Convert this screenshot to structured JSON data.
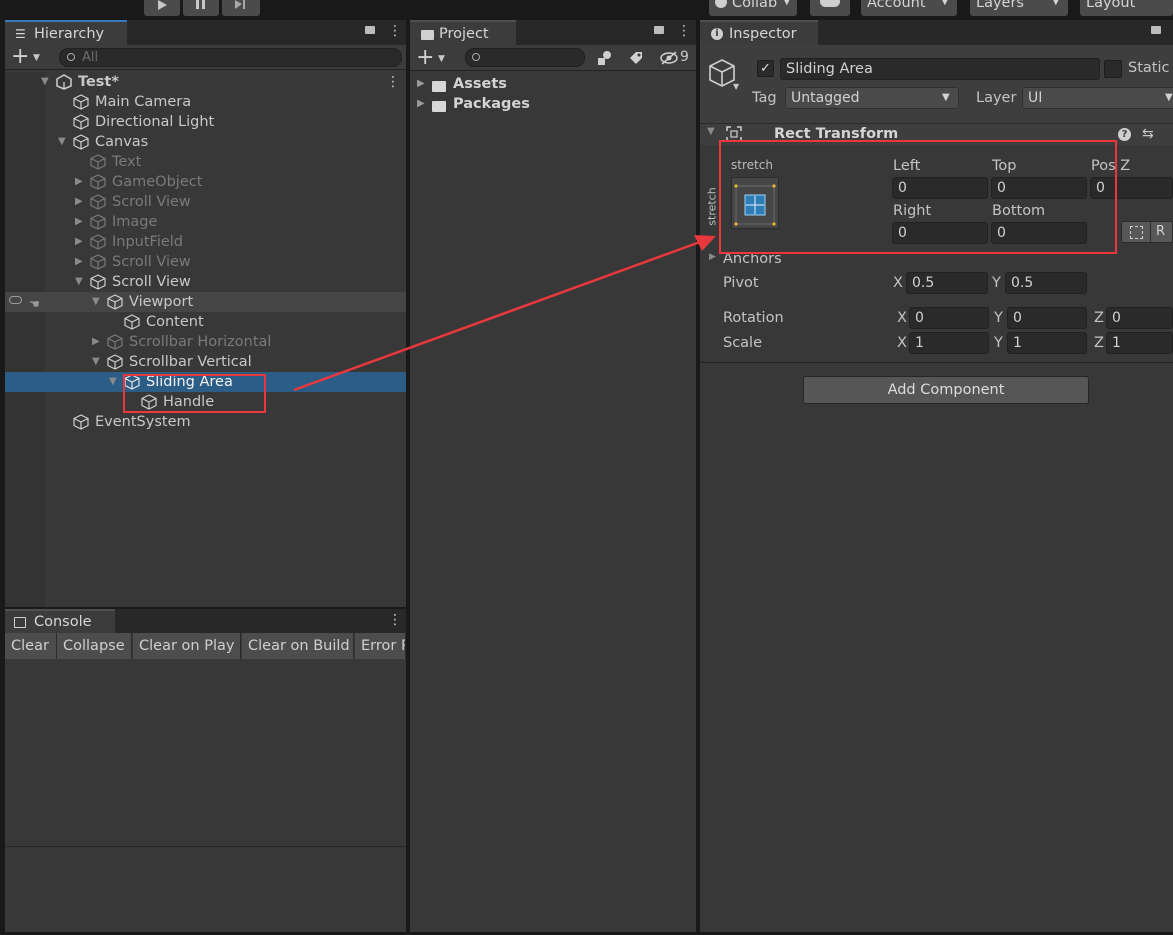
{
  "toolbar": {
    "collab_label": "Collab",
    "account_label": "Account",
    "layers_label": "Layers",
    "layout_label": "Layout"
  },
  "hierarchy": {
    "tab_label": "Hierarchy",
    "search_placeholder": "All",
    "items": [
      {
        "label": "Test*",
        "depth": 0,
        "expanded": true,
        "icon": "unity-scene-icon",
        "dim": false,
        "bold": true
      },
      {
        "label": "Main Camera",
        "depth": 1,
        "icon": "gameobject-cube-icon",
        "dim": false
      },
      {
        "label": "Directional Light",
        "depth": 1,
        "icon": "gameobject-cube-icon",
        "dim": false
      },
      {
        "label": "Canvas",
        "depth": 1,
        "expanded": true,
        "icon": "gameobject-cube-icon",
        "dim": false
      },
      {
        "label": "Text",
        "depth": 2,
        "icon": "gameobject-cube-icon",
        "dim": true
      },
      {
        "label": "GameObject",
        "depth": 2,
        "collapsed": true,
        "icon": "gameobject-cube-icon",
        "dim": true
      },
      {
        "label": "Scroll View",
        "depth": 2,
        "collapsed": true,
        "icon": "gameobject-cube-icon",
        "dim": true
      },
      {
        "label": "Image",
        "depth": 2,
        "collapsed": true,
        "icon": "gameobject-cube-icon",
        "dim": true
      },
      {
        "label": "InputField",
        "depth": 2,
        "collapsed": true,
        "icon": "gameobject-cube-icon",
        "dim": true
      },
      {
        "label": "Scroll View",
        "depth": 2,
        "collapsed": true,
        "icon": "gameobject-cube-icon",
        "dim": true
      },
      {
        "label": "Scroll View",
        "depth": 2,
        "expanded": true,
        "icon": "gameobject-cube-icon",
        "dim": false
      },
      {
        "label": "Viewport",
        "depth": 3,
        "expanded": true,
        "icon": "gameobject-cube-icon",
        "dim": false,
        "hovered": true
      },
      {
        "label": "Content",
        "depth": 4,
        "icon": "gameobject-cube-icon",
        "dim": false
      },
      {
        "label": "Scrollbar Horizontal",
        "depth": 3,
        "collapsed": true,
        "icon": "gameobject-cube-icon",
        "dim": true
      },
      {
        "label": "Scrollbar Vertical",
        "depth": 3,
        "expanded": true,
        "icon": "gameobject-cube-icon",
        "dim": false
      },
      {
        "label": "Sliding Area",
        "depth": 4,
        "expanded": true,
        "icon": "gameobject-cube-icon",
        "dim": false,
        "selected": true
      },
      {
        "label": "Handle",
        "depth": 5,
        "icon": "gameobject-cube-icon",
        "dim": false
      },
      {
        "label": "EventSystem",
        "depth": 1,
        "icon": "gameobject-cube-icon",
        "dim": false
      }
    ]
  },
  "project": {
    "tab_label": "Project",
    "hidden_count": "9",
    "folders": [
      "Assets",
      "Packages"
    ]
  },
  "console": {
    "tab_label": "Console",
    "buttons": [
      "Clear",
      "Collapse",
      "Clear on Play",
      "Clear on Build",
      "Error P"
    ]
  },
  "inspector": {
    "tab_label": "Inspector",
    "object_name": "Sliding Area",
    "active": true,
    "static_label": "Static",
    "tag_label": "Tag",
    "tag_value": "Untagged",
    "layer_label": "Layer",
    "layer_value": "UI",
    "component_title": "Rect Transform",
    "anchor_preset_label": "stretch",
    "anchor_preset_side_label": "stretch",
    "left_label": "Left",
    "left_value": "0",
    "top_label": "Top",
    "top_value": "0",
    "posz_label": "Pos Z",
    "posz_value": "0",
    "right_label": "Right",
    "right_value": "0",
    "bottom_label": "Bottom",
    "bottom_value": "0",
    "raw_edit_label": "R",
    "anchors_label": "Anchors",
    "pivot_label": "Pivot",
    "pivot_x": "0.5",
    "pivot_y": "0.5",
    "rotation_label": "Rotation",
    "rotation_x": "0",
    "rotation_y": "0",
    "rotation_z": "0",
    "scale_label": "Scale",
    "scale_x": "1",
    "scale_y": "1",
    "scale_z": "1",
    "axis_x": "X",
    "axis_y": "Y",
    "axis_z": "Z",
    "add_component_label": "Add Component"
  },
  "colors": {
    "selection": "#2c5d87",
    "annotation": "#e8383d",
    "panel": "#383838",
    "field": "#2a2a2a"
  }
}
